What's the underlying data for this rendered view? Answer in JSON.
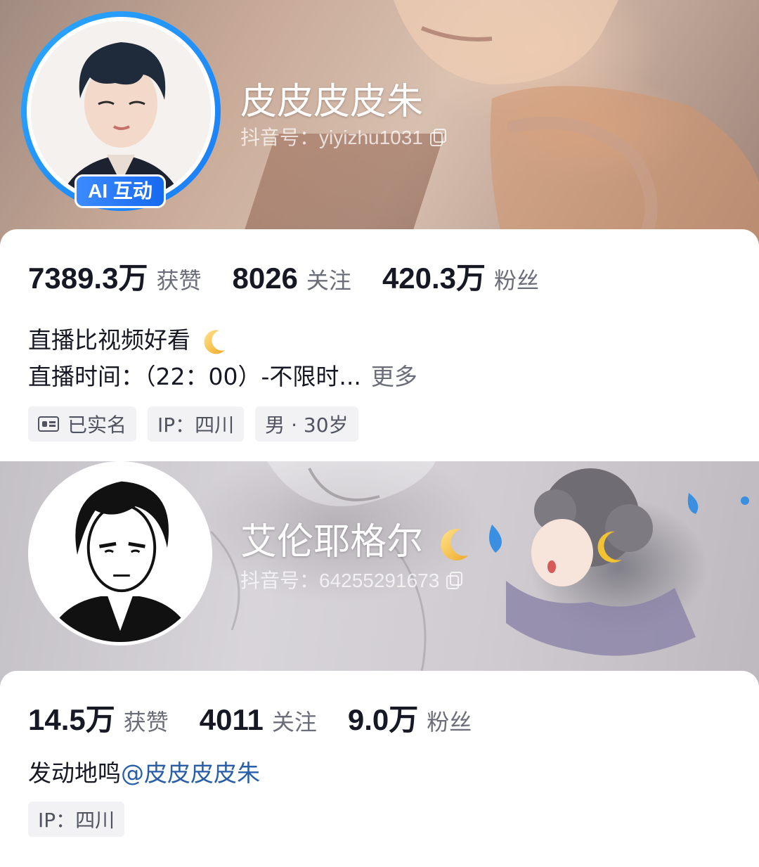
{
  "profiles": [
    {
      "nickname": "皮皮皮皮朱",
      "douyin_id": "抖音号：yiyizhu1031",
      "avatar_badge": "AI 互动",
      "stats": [
        {
          "value": "7389.3万",
          "label": "获赞"
        },
        {
          "value": "8026",
          "label": "关注"
        },
        {
          "value": "420.3万",
          "label": "粉丝"
        }
      ],
      "bio_line1": "直播比视频好看",
      "bio_line2": "直播时间：（22：00）-不限时...",
      "more_label": "更多",
      "tags": [
        "已实名",
        "IP：四川",
        "男 · 30岁"
      ],
      "ring_color": "#1a8cff"
    },
    {
      "nickname": "艾伦耶格尔",
      "douyin_id": "抖音号：64255291673",
      "stats": [
        {
          "value": "14.5万",
          "label": "获赞"
        },
        {
          "value": "4011",
          "label": "关注"
        },
        {
          "value": "9.0万",
          "label": "粉丝"
        }
      ],
      "bio_text": "发动地鸣",
      "bio_mention": "@皮皮皮皮朱",
      "tags": [
        "IP：四川"
      ],
      "mention_color": "#2a5fa8"
    }
  ]
}
